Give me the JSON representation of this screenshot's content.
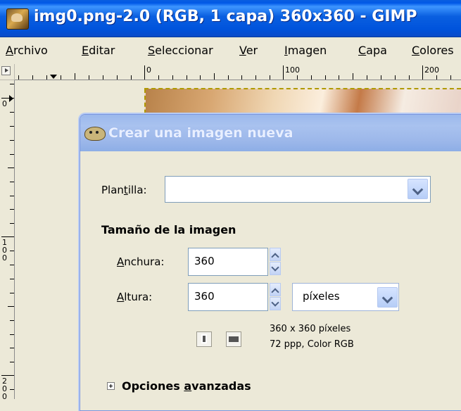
{
  "window": {
    "title": "img0.png-2.0 (RGB, 1 capa) 360x360 - GIMP"
  },
  "menu": [
    {
      "pre": "",
      "mn": "A",
      "post": "rchivo"
    },
    {
      "pre": "",
      "mn": "E",
      "post": "ditar"
    },
    {
      "pre": "",
      "mn": "S",
      "post": "eleccionar"
    },
    {
      "pre": "",
      "mn": "V",
      "post": "er"
    },
    {
      "pre": "",
      "mn": "I",
      "post": "magen"
    },
    {
      "pre": "",
      "mn": "C",
      "post": "apa"
    },
    {
      "pre": "",
      "mn": "C",
      "post": "olores"
    }
  ],
  "rulers": {
    "horizontal": [
      "0",
      "100",
      "200"
    ],
    "vertical": [
      "0",
      "100",
      "200"
    ]
  },
  "dialog": {
    "title": "Crear una imagen nueva",
    "template_label": {
      "pre": "Plan",
      "mn": "t",
      "post": "illa:"
    },
    "template_value": "",
    "size_heading": "Tamaño de la imagen",
    "width_label": {
      "pre": "",
      "mn": "A",
      "post": "nchura:"
    },
    "width_value": "360",
    "height_label": {
      "pre": "",
      "mn": "A",
      "post": "ltura:"
    },
    "height_value": "360",
    "unit_value": "píxeles",
    "info_line1": "360 x 360 píxeles",
    "info_line2": "72 ppp, Color RGB",
    "advanced": {
      "pre": "Opciones ",
      "mn": "a",
      "post": "vanzadas"
    }
  }
}
